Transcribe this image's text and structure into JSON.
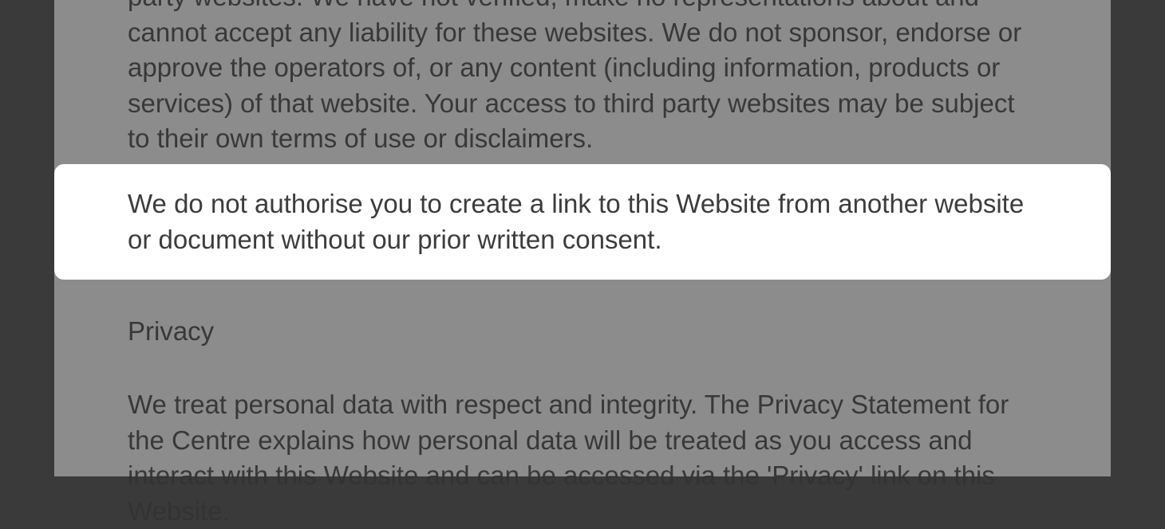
{
  "paragraphs": {
    "links_disclaimer": "party websites. We have not verified, make no representations about and cannot accept any liability for these websites. We do not sponsor, endorse or approve the operators of, or any content (including information, products or services) of that website. Your access to third party websites may be subject to their own terms of use or disclaimers.",
    "link_authorisation": "We do not authorise you to create a link to this Website from another website or document without our prior written consent.",
    "privacy_heading": "Privacy",
    "privacy_body": "We treat personal data with respect and integrity. The Privacy Statement for the Centre explains how personal data will be treated as you access and interact with this Website and can be accessed via the 'Privacy' link on this Website."
  }
}
